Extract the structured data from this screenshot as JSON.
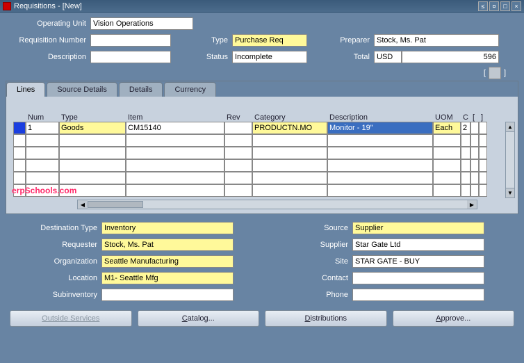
{
  "window": {
    "title": "Requisitions - [New]",
    "unique_session": "※※※※※※※※※※※※※※※"
  },
  "header": {
    "operating_unit_label": "Operating Unit",
    "operating_unit": "Vision Operations",
    "req_number_label": "Requisition Number",
    "req_number": "",
    "type_label": "Type",
    "type": "Purchase Req",
    "preparer_label": "Preparer",
    "preparer": "Stock, Ms. Pat",
    "description_label": "Description",
    "description": "",
    "status_label": "Status",
    "status": "Incomplete",
    "total_label": "Total",
    "total_currency": "USD",
    "total_value": "596"
  },
  "tabs": [
    {
      "label": "Lines",
      "active": true
    },
    {
      "label": "Source Details",
      "active": false
    },
    {
      "label": "Details",
      "active": false
    },
    {
      "label": "Currency",
      "active": false
    }
  ],
  "grid": {
    "columns": [
      "Num",
      "Type",
      "Item",
      "Rev",
      "Category",
      "Description",
      "UOM",
      "C",
      "[",
      "]"
    ],
    "rows": [
      {
        "num": "1",
        "type": "Goods",
        "item": "CM15140",
        "rev": "",
        "category": "PRODUCTN.MO",
        "description": "Monitor - 19\"",
        "uom": "Each",
        "q": "2"
      }
    ],
    "empty_rows": 5
  },
  "watermark": "erpSchools.com",
  "details_left": {
    "destination_type_label": "Destination Type",
    "destination_type": "Inventory",
    "requester_label": "Requester",
    "requester": "Stock, Ms. Pat",
    "organization_label": "Organization",
    "organization": "Seattle Manufacturing",
    "location_label": "Location",
    "location": "M1- Seattle Mfg",
    "subinventory_label": "Subinventory",
    "subinventory": ""
  },
  "details_right": {
    "source_label": "Source",
    "source": "Supplier",
    "supplier_label": "Supplier",
    "supplier": "Star Gate Ltd",
    "site_label": "Site",
    "site": "STAR GATE - BUY",
    "contact_label": "Contact",
    "contact": "",
    "phone_label": "Phone",
    "phone": ""
  },
  "buttons": {
    "outside_services": "Outside Services",
    "catalog": "Catalog...",
    "distributions": "Distributions",
    "approve": "Approve..."
  }
}
